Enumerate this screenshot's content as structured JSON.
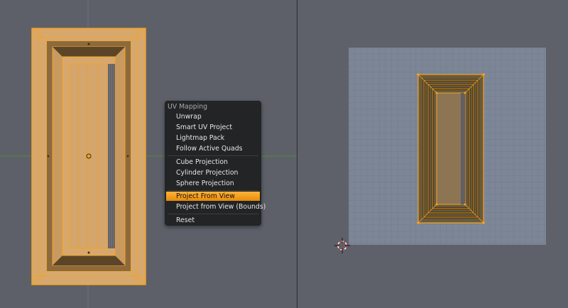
{
  "viewport3d": {
    "name": "3D Viewport",
    "colors": {
      "background": "#5d6068",
      "selected_face": "#d7a86e",
      "edge": "#f5a21e",
      "axis_x": "#8e3b3b",
      "axis_y": "#4f8d3a"
    }
  },
  "uv_editor": {
    "name": "UV/Image Editor",
    "colors": {
      "background": "#5e6169",
      "grid_area": "#7d8696",
      "grid_line": "#6e7685"
    },
    "cursor_icon": "2d-cursor-icon"
  },
  "uv_menu": {
    "title": "UV Mapping",
    "items": [
      {
        "label": "Unwrap",
        "active": false
      },
      {
        "label": "Smart UV Project",
        "active": false
      },
      {
        "label": "Lightmap Pack",
        "active": false
      },
      {
        "label": "Follow Active Quads",
        "active": false
      },
      {
        "label": "Cube Projection",
        "active": false
      },
      {
        "label": "Cylinder Projection",
        "active": false
      },
      {
        "label": "Sphere Projection",
        "active": false
      },
      {
        "label": "Project From View",
        "active": true
      },
      {
        "label": "Project from View (Bounds)",
        "active": false
      },
      {
        "label": "Reset",
        "active": false
      }
    ]
  }
}
